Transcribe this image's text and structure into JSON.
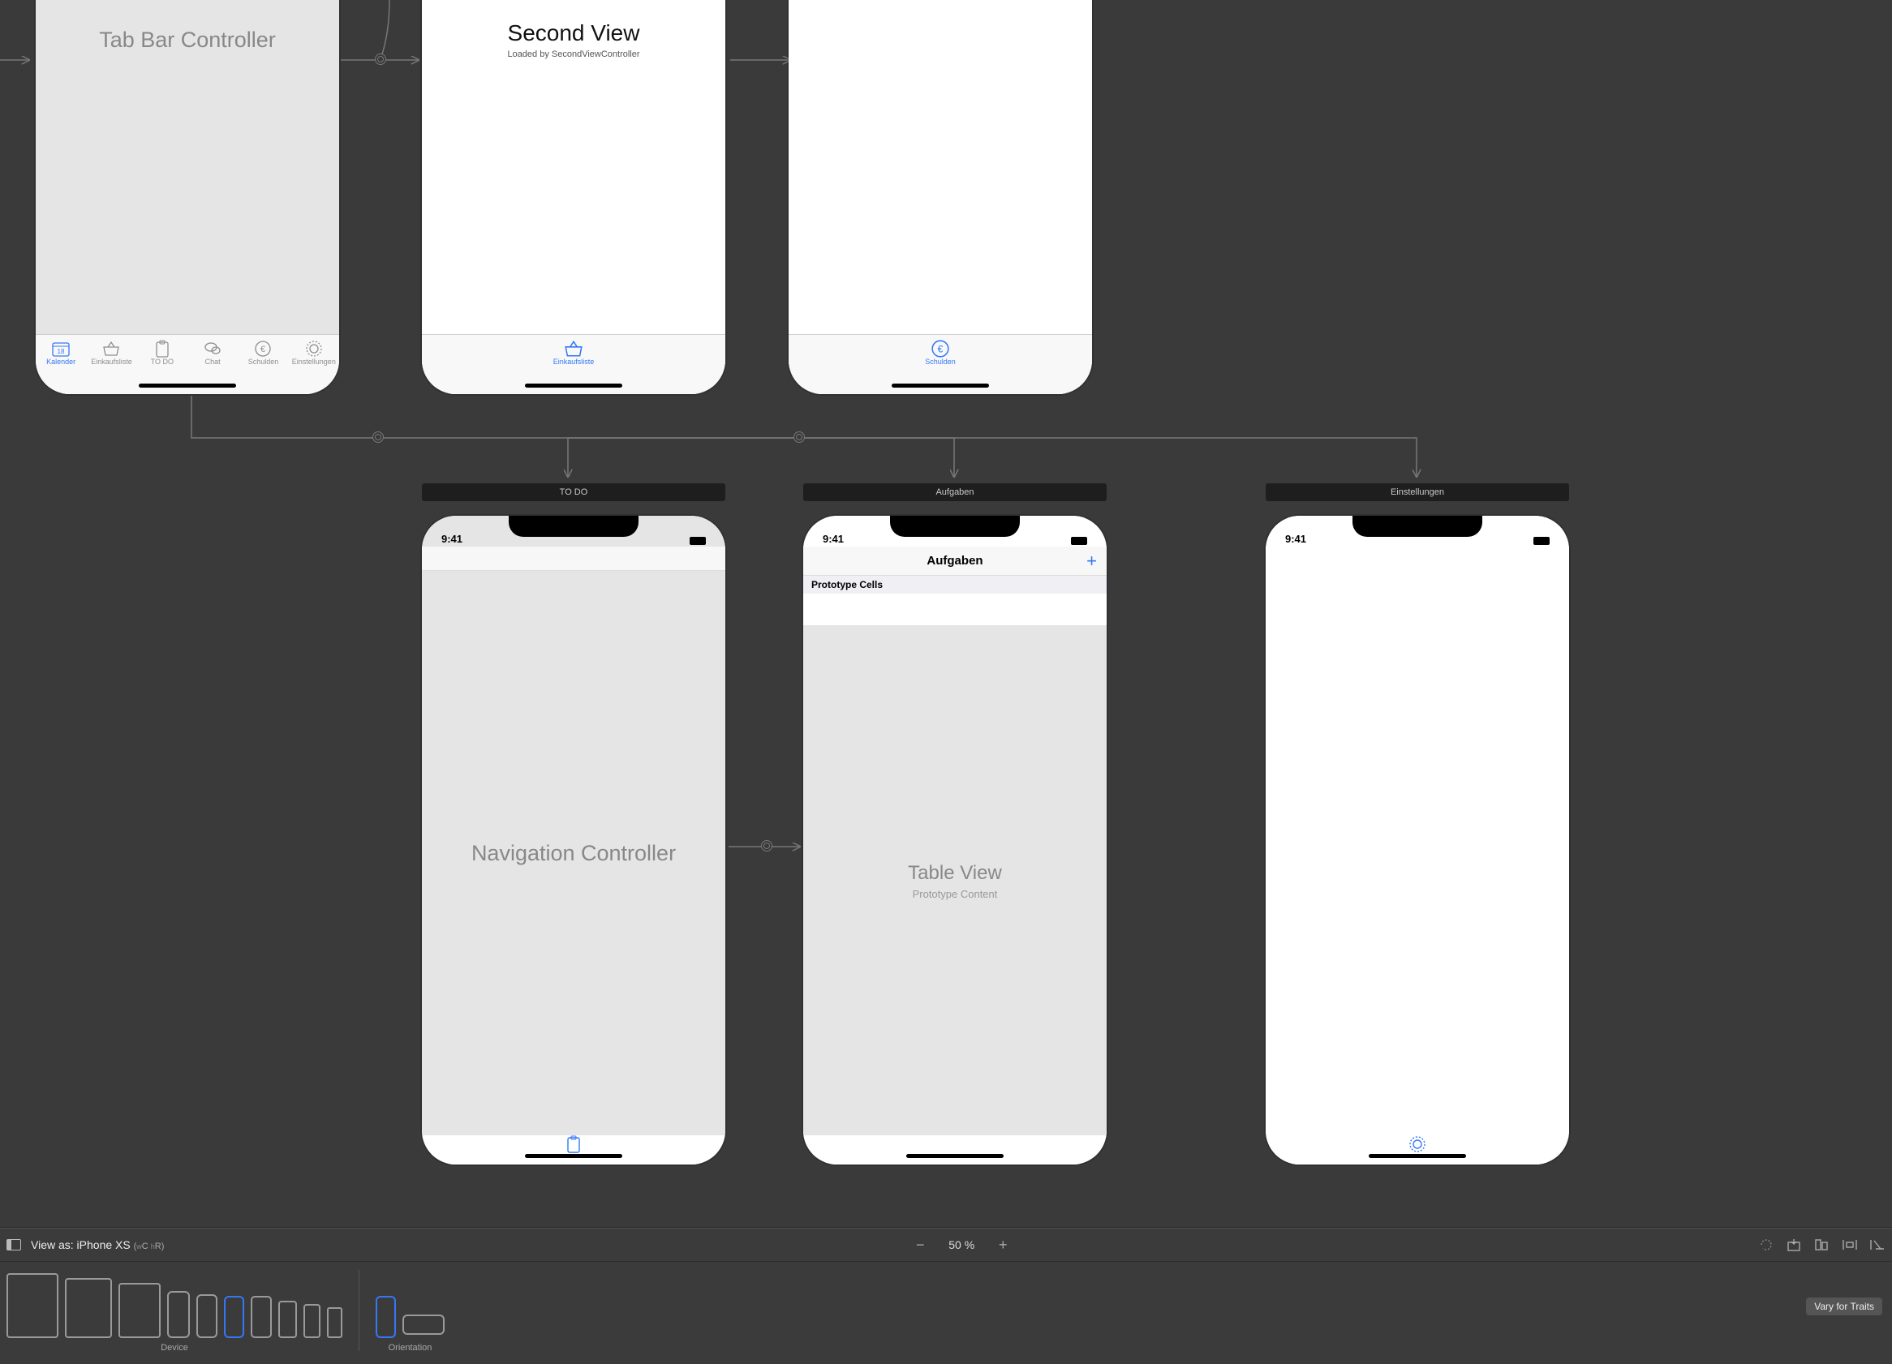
{
  "tabbar_controller": {
    "title": "Tab Bar Controller",
    "tabs": [
      {
        "label": "Kalender",
        "icon": "calendar"
      },
      {
        "label": "Einkaufsliste",
        "icon": "basket"
      },
      {
        "label": "TO DO",
        "icon": "clipboard"
      },
      {
        "label": "Chat",
        "icon": "chat"
      },
      {
        "label": "Schulden",
        "icon": "euro"
      },
      {
        "label": "Einstellungen",
        "icon": "gear"
      }
    ]
  },
  "second_view": {
    "title": "Second View",
    "subtitle": "Loaded by SecondViewController",
    "tab": {
      "label": "Einkaufsliste",
      "icon": "basket"
    }
  },
  "schulden_view": {
    "tab": {
      "label": "Schulden",
      "icon": "euro"
    }
  },
  "nav_controller": {
    "scene_title": "TO DO",
    "title": "Navigation Controller",
    "status_time": "9:41",
    "tab_icon": "clipboard"
  },
  "aufgaben": {
    "scene_title": "Aufgaben",
    "nav_title": "Aufgaben",
    "status_time": "9:41",
    "prototype_header": "Prototype Cells",
    "table_title": "Table View",
    "table_subtitle": "Prototype Content"
  },
  "einstellungen": {
    "scene_title": "Einstellungen",
    "status_time": "9:41",
    "tab_icon": "gear"
  },
  "toolbar": {
    "viewas_prefix": "View as: ",
    "viewas_device": "iPhone XS",
    "size_class": "(wC hR)",
    "zoom": "50 %",
    "device_label": "Device",
    "orientation_label": "Orientation",
    "vary_label": "Vary for Traits"
  }
}
